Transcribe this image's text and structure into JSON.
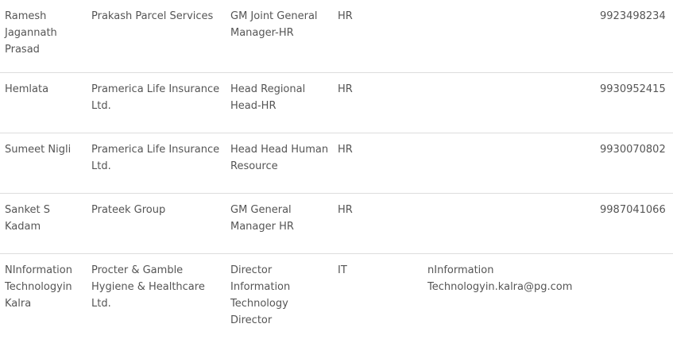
{
  "contacts_table": {
    "rows": [
      {
        "name": "Ramesh Jagannath Prasad",
        "company": "Prakash Parcel Services",
        "designation": "GM Joint General Manager-HR",
        "department": "HR",
        "email": "",
        "phone": "9923498234"
      },
      {
        "name": "Hemlata",
        "company": "Pramerica Life Insurance Ltd.",
        "designation": "Head Regional Head-HR",
        "department": "HR",
        "email": "",
        "phone": "9930952415"
      },
      {
        "name": "Sumeet Nigli",
        "company": "Pramerica Life Insurance Ltd.",
        "designation": "Head Head Human Resource",
        "department": "HR",
        "email": "",
        "phone": "9930070802"
      },
      {
        "name": "Sanket S Kadam",
        "company": "Prateek Group",
        "designation": "GM General Manager HR",
        "department": "HR",
        "email": "",
        "phone": "9987041066"
      },
      {
        "name": "NInformation Technologyin Kalra",
        "company": "Procter & Gamble Hygiene & Healthcare Ltd.",
        "designation": "Director Information Technology Director",
        "department": "IT",
        "email": "nInformation Technologyin.kalra@pg.com",
        "phone": ""
      }
    ]
  }
}
